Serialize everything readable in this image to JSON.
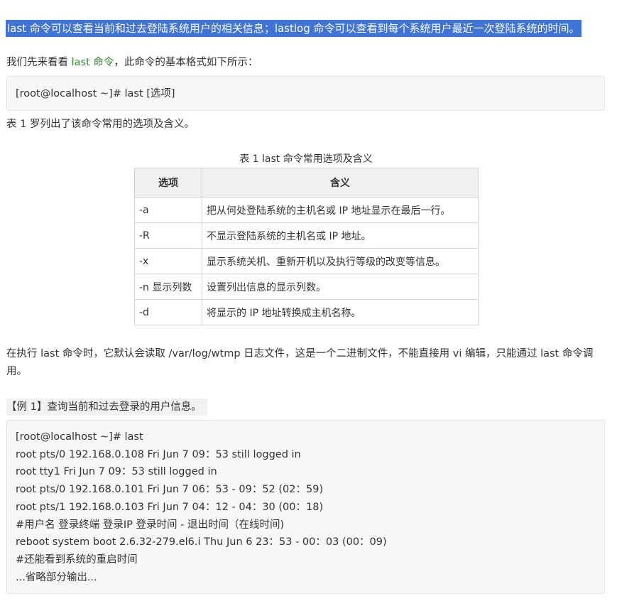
{
  "intro_highlight": "last 命令可以查看当前和过去登陆系统用户的相关信息；lastlog 命令可以查看到每个系统用户最近一次登陆系统的时间。",
  "format_intro": {
    "before": "我们先来看看 ",
    "link": "last 命令",
    "after": "，此命令的基本格式如下所示："
  },
  "format_code": "[root@localhost ~]# last [选项]",
  "table_intro": "表 1 罗列出了该命令常用的选项及含义。",
  "table": {
    "caption": "表 1 last 命令常用选项及含义",
    "headers": [
      "选项",
      "含义"
    ],
    "rows": [
      [
        "-a",
        "把从何处登陆系统的主机名或 IP 地址显示在最后一行。"
      ],
      [
        "-R",
        "不显示登陆系统的主机名或 IP 地址。"
      ],
      [
        "-x",
        "显示系统关机、重新开机以及执行等级的改变等信息。"
      ],
      [
        "-n 显示列数",
        "设置列出信息的显示列数。"
      ],
      [
        "-d",
        "将显示的 IP 地址转换成主机名称。"
      ]
    ]
  },
  "wtmp_paragraph": "在执行 last 命令时，它默认会读取 /var/log/wtmp 日志文件，这是一个二进制文件，不能直接用 vi 编辑，只能通过 last 命令调用。",
  "example_label": "【例 1】查询当前和过去登录的用户信息。",
  "example_code": [
    "[root@localhost ~]# last",
    "root pts/0 192.168.0.108 Fri Jun 7 09：53 still logged in",
    "root tty1 Fri Jun 7 09：53 still logged in",
    "root pts/0 192.168.0.101 Fri Jun 7 06：53 - 09：52 (02：59)",
    "root pts/1 192.168.0.103 Fri Jun 7 04：12 - 04：30 (00：18)",
    "#用户名 登录终端 登录IP 登录时间 - 退出时间（在线时间)",
    "reboot system boot 2.6.32-279.el6.i Thu Jun 6 23：53 - 00：03 (00：09)",
    "#还能看到系统的重启时间",
    "...省略部分输出..."
  ]
}
